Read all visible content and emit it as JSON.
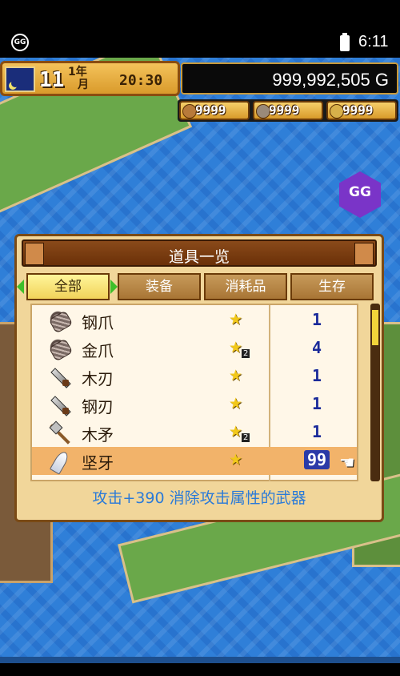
{
  "status_bar": {
    "time": "6:11",
    "app_icon": "GG"
  },
  "hud": {
    "year": "1年",
    "month_num": "11",
    "month_unit": "月",
    "clock": "20:30",
    "money": "999,992,505 G",
    "resources": [
      {
        "icon": "wood-icon",
        "value": "9999"
      },
      {
        "icon": "ore-icon",
        "value": "9999"
      },
      {
        "icon": "food-icon",
        "value": "9999"
      }
    ]
  },
  "gg_button": {
    "label": "GG"
  },
  "dialog": {
    "title": "道具一览",
    "tabs": [
      {
        "label": "全部",
        "active": true
      },
      {
        "label": "装备",
        "active": false
      },
      {
        "label": "消耗品",
        "active": false
      },
      {
        "label": "生存",
        "active": false
      }
    ],
    "items": [
      {
        "icon": "claw-icon",
        "name": "钢爪",
        "star_count": "",
        "qty": "1",
        "selected": false
      },
      {
        "icon": "claw-icon",
        "name": "金爪",
        "star_count": "2",
        "qty": "4",
        "selected": false
      },
      {
        "icon": "blade-icon",
        "name": "木刃",
        "star_count": "",
        "qty": "1",
        "selected": false
      },
      {
        "icon": "blade-icon",
        "name": "钢刃",
        "star_count": "",
        "qty": "1",
        "selected": false
      },
      {
        "icon": "spear-icon",
        "name": "木矛",
        "star_count": "2",
        "qty": "1",
        "selected": false
      },
      {
        "icon": "fang-icon",
        "name": "坚牙",
        "star_count": "",
        "qty": "99",
        "selected": true
      }
    ],
    "description": "攻击+390 消除攻击属性的武器"
  }
}
